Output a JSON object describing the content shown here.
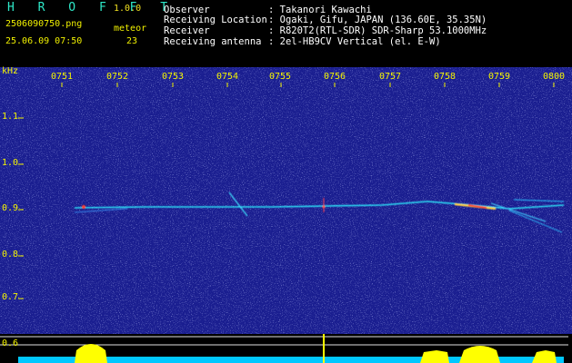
{
  "header": {
    "app_name": "H R O F F T",
    "version": "1.0.0",
    "file_name": "2506090750.png",
    "detection_label": "meteor",
    "datetime": "25.06.09 07:50",
    "meteor_count": "23",
    "fields": [
      {
        "label": "Observer",
        "value": ": Takanori Kawachi"
      },
      {
        "label": "Receiving Location",
        "value": ": Ogaki, Gifu, JAPAN (136.60E, 35.35N)"
      },
      {
        "label": "Receiver",
        "value": ": R820T2(RTL-SDR) SDR-Sharp 53.1000MHz"
      },
      {
        "label": "Receiving antenna",
        "value": ": 2el-HB9CV Vertical (el. E-W)"
      }
    ]
  },
  "spectrogram": {
    "y_unit": "kHz",
    "y_ticks": [
      "1.1",
      "1.0",
      "0.9",
      "0.8",
      "0.7",
      "0.6"
    ],
    "x_ticks": [
      "0751",
      "0752",
      "0753",
      "0754",
      "0755",
      "0756",
      "0757",
      "0758",
      "0759",
      "0800"
    ],
    "colors": {
      "background": "#1a1e90",
      "signal": "#2ff0ff",
      "hot": "#ff4030",
      "level": "#ffff00",
      "noise_floor": "#00c8ff"
    }
  }
}
